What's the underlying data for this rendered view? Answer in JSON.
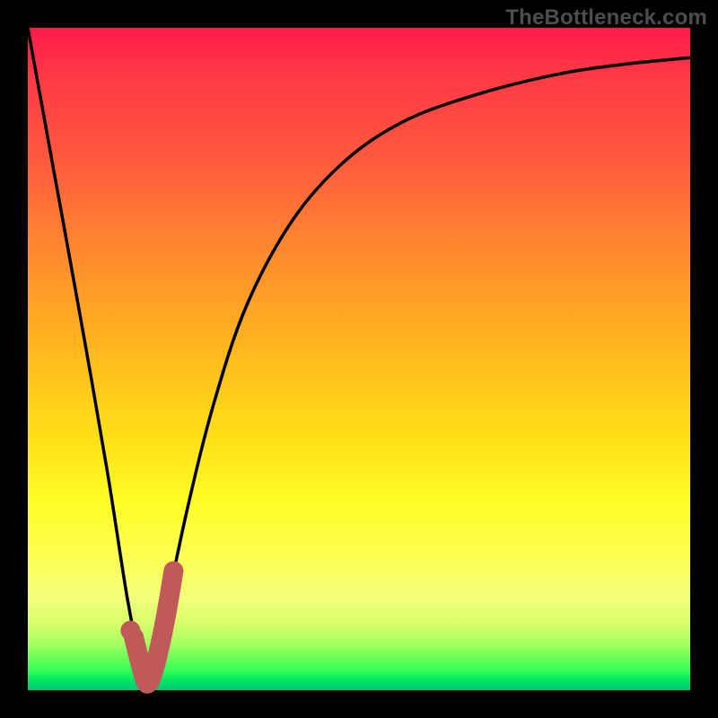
{
  "watermark": "TheBottleneck.com",
  "chart_data": {
    "type": "line",
    "title": "",
    "xlabel": "",
    "ylabel": "",
    "xlim": [
      0,
      100
    ],
    "ylim": [
      0,
      100
    ],
    "series": [
      {
        "name": "bottleneck-curve",
        "x": [
          0,
          4,
          8,
          12,
          15,
          17,
          18,
          19,
          20,
          24,
          28,
          33,
          40,
          48,
          57,
          68,
          80,
          90,
          100
        ],
        "values": [
          100,
          78,
          56,
          33,
          14,
          4,
          1,
          3,
          8,
          27,
          43,
          58,
          71,
          80,
          86,
          90,
          93,
          94.5,
          95.5
        ]
      }
    ],
    "highlight": {
      "name": "selected-range",
      "color": "#c05a5a",
      "x": [
        16,
        17,
        18,
        19,
        20,
        21,
        22
      ],
      "values": [
        8,
        4,
        1,
        3,
        7,
        12,
        18
      ]
    },
    "highlight_point": {
      "x": 15.5,
      "y": 9
    }
  },
  "colors": {
    "curve": "#000000",
    "highlight": "#c05a5a",
    "watermark": "#4d4d4d"
  }
}
